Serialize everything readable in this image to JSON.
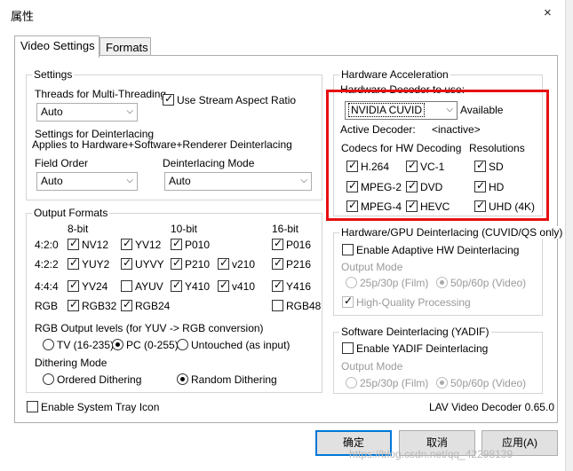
{
  "window": {
    "title": "属性",
    "close_icon": "×"
  },
  "tabs": [
    {
      "label": "Video Settings"
    },
    {
      "label": "Formats"
    }
  ],
  "settings": {
    "group_title": "Settings",
    "threads_label": "Threads for Multi-Threading",
    "threads_value": "Auto",
    "stream_aspect_label": "Use Stream Aspect Ratio",
    "stream_aspect_checked": true,
    "deint_settings_line1": "Settings for Deinterlacing",
    "deint_settings_line2": "Applies to Hardware+Software+Renderer Deinterlacing",
    "field_order_label": "Field Order",
    "field_order_value": "Auto",
    "deint_mode_label": "Deinterlacing Mode",
    "deint_mode_value": "Auto"
  },
  "output_formats": {
    "group_title": "Output Formats",
    "col_8bit": "8-bit",
    "col_10bit": "10-bit",
    "col_16bit": "16-bit",
    "rows": [
      {
        "label": "4:2:0",
        "items": [
          {
            "label": "NV12",
            "checked": true
          },
          {
            "label": "YV12",
            "checked": true
          },
          {
            "label": "P010",
            "checked": true
          },
          {
            "label": "P016",
            "checked": true
          }
        ]
      },
      {
        "label": "4:2:2",
        "items": [
          {
            "label": "YUY2",
            "checked": true
          },
          {
            "label": "UYVY",
            "checked": true
          },
          {
            "label": "P210",
            "checked": true
          },
          {
            "label": "v210",
            "checked": true
          },
          {
            "label": "P216",
            "checked": true
          }
        ]
      },
      {
        "label": "4:4:4",
        "items": [
          {
            "label": "YV24",
            "checked": true
          },
          {
            "label": "AYUV",
            "checked": false
          },
          {
            "label": "Y410",
            "checked": true
          },
          {
            "label": "v410",
            "checked": true
          },
          {
            "label": "Y416",
            "checked": true
          }
        ]
      },
      {
        "label": "RGB",
        "items": [
          {
            "label": "RGB32",
            "checked": true
          },
          {
            "label": "RGB24",
            "checked": true
          },
          {
            "label": "RGB48",
            "checked": false
          }
        ]
      }
    ],
    "rgb_levels_label": "RGB Output levels (for YUV -> RGB conversion)",
    "rgb_levels": [
      {
        "label": "TV (16-235)",
        "selected": false
      },
      {
        "label": "PC (0-255)",
        "selected": true
      },
      {
        "label": "Untouched (as input)",
        "selected": false
      }
    ],
    "dithering_label": "Dithering Mode",
    "dithering": [
      {
        "label": "Ordered Dithering",
        "selected": false
      },
      {
        "label": "Random Dithering",
        "selected": true
      }
    ]
  },
  "system_tray_label": "Enable System Tray Icon",
  "hw_accel": {
    "group_title": "Hardware Acceleration",
    "decoder_label": "Hardware Decoder to use:",
    "decoder_value": "NVIDIA CUVID",
    "available_label": "Available",
    "active_decoder_label": "Active Decoder:",
    "active_decoder_value": "<inactive>",
    "codecs_label": "Codecs for HW Decoding",
    "resolutions_label": "Resolutions",
    "codecs": [
      {
        "label": "H.264",
        "checked": true
      },
      {
        "label": "VC-1",
        "checked": true
      },
      {
        "label": "MPEG-2",
        "checked": true
      },
      {
        "label": "DVD",
        "checked": true
      },
      {
        "label": "MPEG-4",
        "checked": true
      },
      {
        "label": "HEVC",
        "checked": true
      }
    ],
    "resolutions": [
      {
        "label": "SD",
        "checked": true
      },
      {
        "label": "HD",
        "checked": true
      },
      {
        "label": "UHD (4K)",
        "checked": true
      }
    ]
  },
  "gpu_deint": {
    "group_title": "Hardware/GPU Deinterlacing (CUVID/QS only)",
    "enable_label": "Enable Adaptive HW Deinterlacing",
    "output_mode_label": "Output Mode",
    "film_label": "25p/30p (Film)",
    "video_label": "50p/60p (Video)",
    "hq_label": "High-Quality Processing"
  },
  "sw_deint": {
    "group_title": "Software Deinterlacing (YADIF)",
    "enable_label": "Enable YADIF Deinterlacing",
    "output_mode_label": "Output Mode",
    "film_label": "25p/30p (Film)",
    "video_label": "50p/60p (Video)"
  },
  "version_label": "LAV Video Decoder 0.65.0",
  "buttons": {
    "ok": "确定",
    "cancel": "取消",
    "apply": "应用(A)"
  },
  "watermark": "https://blog.csdn.net/qq_42298139",
  "colors": {
    "highlight_box": "#e61010",
    "primary_button_border": "#0078d7"
  }
}
